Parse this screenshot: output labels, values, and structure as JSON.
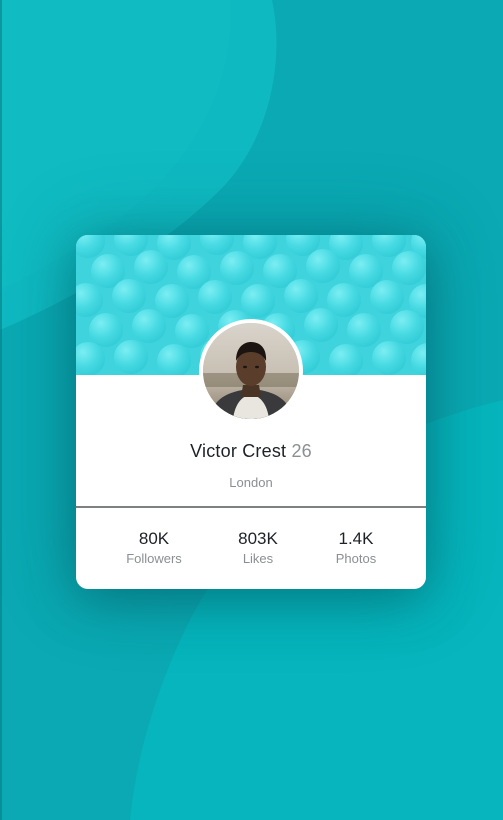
{
  "profile": {
    "name": "Victor Crest",
    "age": "26",
    "city": "London"
  },
  "stats": [
    {
      "value": "80K",
      "label": "Followers"
    },
    {
      "value": "803K",
      "label": "Likes"
    },
    {
      "value": "1.4K",
      "label": "Photos"
    }
  ],
  "colors": {
    "background": "#0aa9b3",
    "header": "#3ed3dd",
    "card": "#ffffff",
    "primary_text": "#1d2228",
    "secondary_text": "#8b8f93"
  }
}
